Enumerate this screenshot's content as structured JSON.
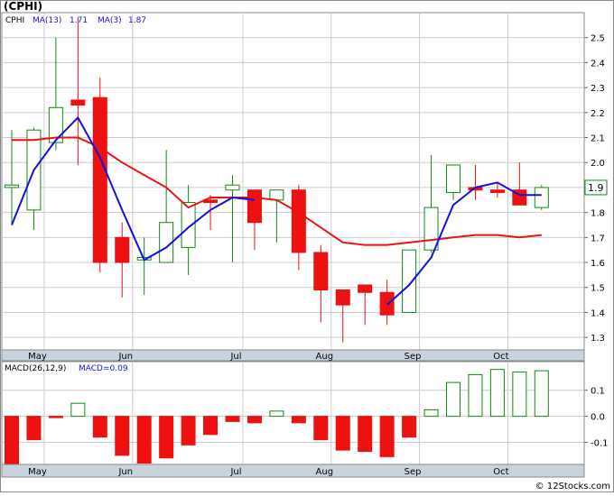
{
  "title": "(CPHI)",
  "watermark": "© 12Stocks.com",
  "chart_data": [
    {
      "type": "candlestick",
      "ticker": "CPHI",
      "legend": {
        "ticker_label": "CPHI",
        "ma13_label": "MA(13)",
        "ma13_value": "1.71",
        "ma3_label": "MA(3)",
        "ma3_value": "1.87"
      },
      "months": [
        "May",
        "Jun",
        "Jul",
        "Aug",
        "Sep",
        "Oct"
      ],
      "month_index": [
        1,
        5,
        10,
        14,
        18,
        22
      ],
      "ylim": [
        1.25,
        2.6
      ],
      "yticks": [
        "2.5",
        "2.4",
        "2.3",
        "2.2",
        "2.1",
        "2.0",
        "1.9",
        "1.8",
        "1.7",
        "1.6",
        "1.5",
        "1.4",
        "1.3"
      ],
      "last_price": "1.9",
      "grid": true,
      "colors": {
        "up": "#118811",
        "down": "#ee1111",
        "ma13": "#ee1111",
        "ma3": "#1111dd",
        "grid": "#cccccc",
        "axis_bg": "#c8d3de"
      },
      "candles": [
        {
          "o": 1.9,
          "h": 2.13,
          "l": 1.75,
          "c": 1.91
        },
        {
          "o": 1.81,
          "h": 2.14,
          "l": 1.73,
          "c": 2.13
        },
        {
          "o": 2.08,
          "h": 2.5,
          "l": 2.05,
          "c": 2.22
        },
        {
          "o": 2.25,
          "h": 2.58,
          "l": 1.99,
          "c": 2.23
        },
        {
          "o": 2.26,
          "h": 2.34,
          "l": 1.56,
          "c": 1.6
        },
        {
          "o": 1.7,
          "h": 1.76,
          "l": 1.46,
          "c": 1.6
        },
        {
          "o": 1.61,
          "h": 1.7,
          "l": 1.47,
          "c": 1.62
        },
        {
          "o": 1.6,
          "h": 2.05,
          "l": 1.6,
          "c": 1.76
        },
        {
          "o": 1.66,
          "h": 1.91,
          "l": 1.55,
          "c": 1.84
        },
        {
          "o": 1.85,
          "h": 1.87,
          "l": 1.73,
          "c": 1.84
        },
        {
          "o": 1.89,
          "h": 1.95,
          "l": 1.6,
          "c": 1.91
        },
        {
          "o": 1.89,
          "h": 1.89,
          "l": 1.65,
          "c": 1.76
        },
        {
          "o": 1.85,
          "h": 1.89,
          "l": 1.68,
          "c": 1.89
        },
        {
          "o": 1.89,
          "h": 1.91,
          "l": 1.57,
          "c": 1.64
        },
        {
          "o": 1.64,
          "h": 1.67,
          "l": 1.36,
          "c": 1.49
        },
        {
          "o": 1.49,
          "h": 1.49,
          "l": 1.28,
          "c": 1.43
        },
        {
          "o": 1.51,
          "h": 1.51,
          "l": 1.35,
          "c": 1.48
        },
        {
          "o": 1.48,
          "h": 1.53,
          "l": 1.35,
          "c": 1.39
        },
        {
          "o": 1.4,
          "h": 1.65,
          "l": 1.4,
          "c": 1.65
        },
        {
          "o": 1.65,
          "h": 2.03,
          "l": 1.64,
          "c": 1.82
        },
        {
          "o": 1.88,
          "h": 1.99,
          "l": 1.85,
          "c": 1.99
        },
        {
          "o": 1.9,
          "h": 1.99,
          "l": 1.85,
          "c": 1.89
        },
        {
          "o": 1.89,
          "h": 1.92,
          "l": 1.86,
          "c": 1.88
        },
        {
          "o": 1.89,
          "h": 2.0,
          "l": 1.83,
          "c": 1.83
        },
        {
          "o": 1.82,
          "h": 1.91,
          "l": 1.81,
          "c": 1.9
        }
      ],
      "ma13": [
        [
          0,
          2.09
        ],
        [
          1,
          2.09
        ],
        [
          2,
          2.1
        ],
        [
          3,
          2.1
        ],
        [
          4,
          2.06
        ],
        [
          5,
          2.0
        ],
        [
          6,
          1.95
        ],
        [
          7,
          1.9
        ],
        [
          8,
          1.82
        ],
        [
          9,
          1.86
        ],
        [
          10,
          1.86
        ],
        [
          11,
          1.86
        ],
        [
          12,
          1.85
        ],
        [
          13,
          1.8
        ],
        [
          14,
          1.74
        ],
        [
          15,
          1.68
        ],
        [
          16,
          1.67
        ],
        [
          17,
          1.67
        ],
        [
          18,
          1.68
        ],
        [
          19,
          1.69
        ],
        [
          20,
          1.7
        ],
        [
          21,
          1.71
        ],
        [
          22,
          1.71
        ],
        [
          23,
          1.7
        ],
        [
          24,
          1.71
        ]
      ],
      "ma3": [
        [
          0,
          1.75
        ],
        [
          1,
          1.97
        ],
        [
          2,
          2.09
        ],
        [
          3,
          2.18
        ],
        [
          4,
          2.02
        ],
        [
          5,
          1.81
        ],
        [
          6,
          1.61
        ],
        [
          7,
          1.66
        ],
        [
          8,
          1.74
        ],
        [
          9,
          1.81
        ],
        [
          10,
          1.86
        ],
        [
          11,
          1.85
        ],
        [
          17,
          1.43
        ],
        [
          18,
          1.51
        ],
        [
          19,
          1.62
        ],
        [
          20,
          1.83
        ],
        [
          21,
          1.9
        ],
        [
          22,
          1.92
        ],
        [
          23,
          1.87
        ],
        [
          24,
          1.87
        ]
      ]
    },
    {
      "type": "bar",
      "legend": {
        "label": "MACD(26,12,9)",
        "value_label": "MACD=0.09"
      },
      "months": [
        "May",
        "Jun",
        "Jul",
        "Aug",
        "Sep",
        "Oct"
      ],
      "month_index": [
        1,
        5,
        10,
        14,
        18,
        22
      ],
      "ylim": [
        -0.185,
        0.21
      ],
      "yticks": [
        {
          "v": 0.1,
          "label": "0.1"
        },
        {
          "v": 0.0,
          "label": "0.0"
        },
        {
          "v": -0.1,
          "label": "-0.1"
        }
      ],
      "values": [
        -0.19,
        -0.09,
        -0.005,
        0.05,
        -0.08,
        -0.15,
        -0.18,
        -0.16,
        -0.11,
        -0.07,
        -0.02,
        -0.025,
        0.02,
        -0.025,
        -0.09,
        -0.13,
        -0.135,
        -0.155,
        -0.08,
        0.025,
        0.13,
        0.16,
        0.18,
        0.17,
        0.175
      ]
    }
  ]
}
